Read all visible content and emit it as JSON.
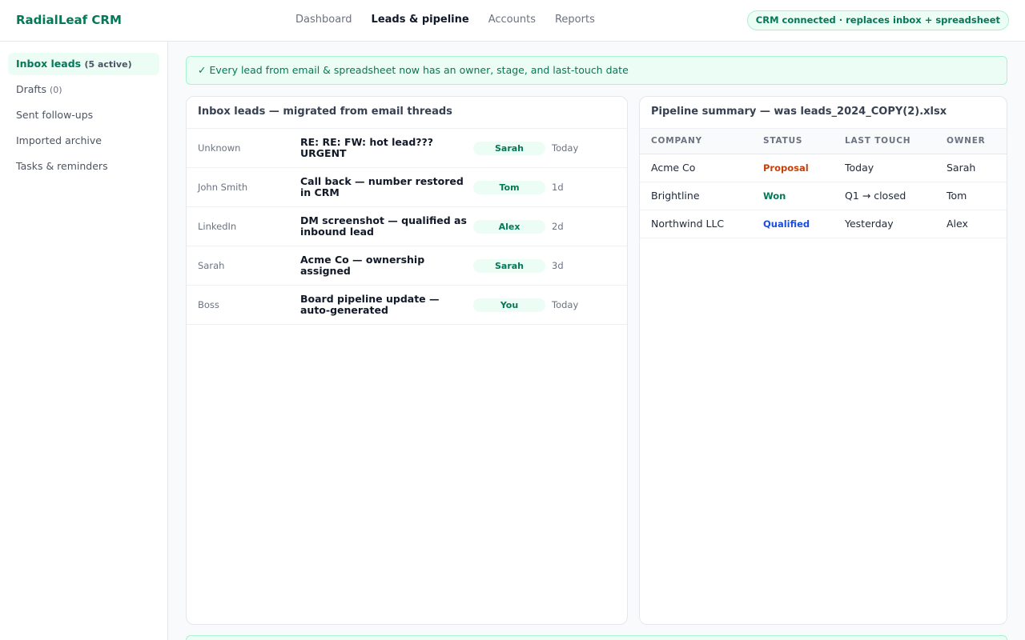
{
  "app": {
    "title": "RadialLeaf CRM"
  },
  "nav": {
    "items": [
      {
        "label": "Dashboard",
        "active": false
      },
      {
        "label": "Leads & pipeline",
        "active": true
      },
      {
        "label": "Accounts",
        "active": false
      },
      {
        "label": "Reports",
        "active": false
      }
    ]
  },
  "status_pill": "CRM connected · replaces inbox + spreadsheet",
  "sidebar": {
    "items": [
      {
        "label": "Inbox leads",
        "count": "(5 active)",
        "active": true
      },
      {
        "label": "Drafts",
        "count": "(0)",
        "active": false
      },
      {
        "label": "Sent follow-ups",
        "count": "",
        "active": false
      },
      {
        "label": "Imported archive",
        "count": "",
        "active": false
      },
      {
        "label": "Tasks & reminders",
        "count": "",
        "active": false
      }
    ]
  },
  "banner": "✓ Every lead from email & spreadsheet now has an owner, stage, and last-touch date",
  "inbox": {
    "title": "Inbox leads — migrated from email threads",
    "rows": [
      {
        "from": "Unknown",
        "subject": "RE: RE: FW: hot lead??? URGENT",
        "owner": "Sarah",
        "date": "Today"
      },
      {
        "from": "John Smith",
        "subject": "Call back — number restored in CRM",
        "owner": "Tom",
        "date": "1d"
      },
      {
        "from": "LinkedIn",
        "subject": "DM screenshot — qualified as inbound lead",
        "owner": "Alex",
        "date": "2d"
      },
      {
        "from": "Sarah",
        "subject": "Acme Co — ownership assigned",
        "owner": "Sarah",
        "date": "3d"
      },
      {
        "from": "Boss",
        "subject": "Board pipeline update — auto-generated",
        "owner": "You",
        "date": "Today"
      }
    ]
  },
  "pipeline": {
    "title": "Pipeline summary — was leads_2024_COPY(2).xlsx",
    "columns": [
      "COMPANY",
      "STATUS",
      "LAST TOUCH",
      "OWNER"
    ],
    "rows": [
      {
        "company": "Acme Co",
        "status": "Proposal",
        "status_color": "#c2410c",
        "last_touch": "Today",
        "owner": "Sarah"
      },
      {
        "company": "Brightline",
        "status": "Won",
        "status_color": "#047857",
        "last_touch": "Q1 → closed",
        "owner": "Tom"
      },
      {
        "company": "Northwind LLC",
        "status": "Qualified",
        "status_color": "#1d4ed8",
        "last_touch": "Yesterday",
        "owner": "Alex"
      }
    ]
  },
  "colors": {
    "brand": "#047857",
    "accent_bg": "#ecfdf5",
    "accent_border": "#a7f3d0"
  }
}
